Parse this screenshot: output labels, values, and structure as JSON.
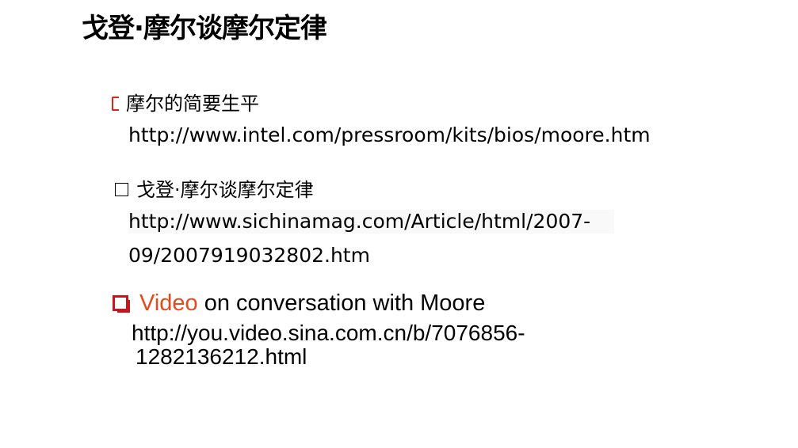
{
  "title": "戈登·摩尔谈摩尔定律",
  "items": [
    {
      "label": "摩尔的简要生平",
      "url_lines": [
        "http://www.intel.com/pressroom/kits/bios/moore.htm"
      ]
    },
    {
      "label": "戈登·摩尔谈摩尔定律",
      "url_lines": [
        "http://www.sichinamag.com/Article/html/2007-",
        "09/2007919032802.htm"
      ]
    },
    {
      "label_highlight": "Video",
      "label_rest": " on conversation with Moore",
      "url_lines": [
        "http://you.video.sina.com.cn/b/7076856-",
        "1282136212.html"
      ]
    }
  ],
  "colors": {
    "highlight": "#e8481c",
    "bullet_red": "#c4161c"
  }
}
